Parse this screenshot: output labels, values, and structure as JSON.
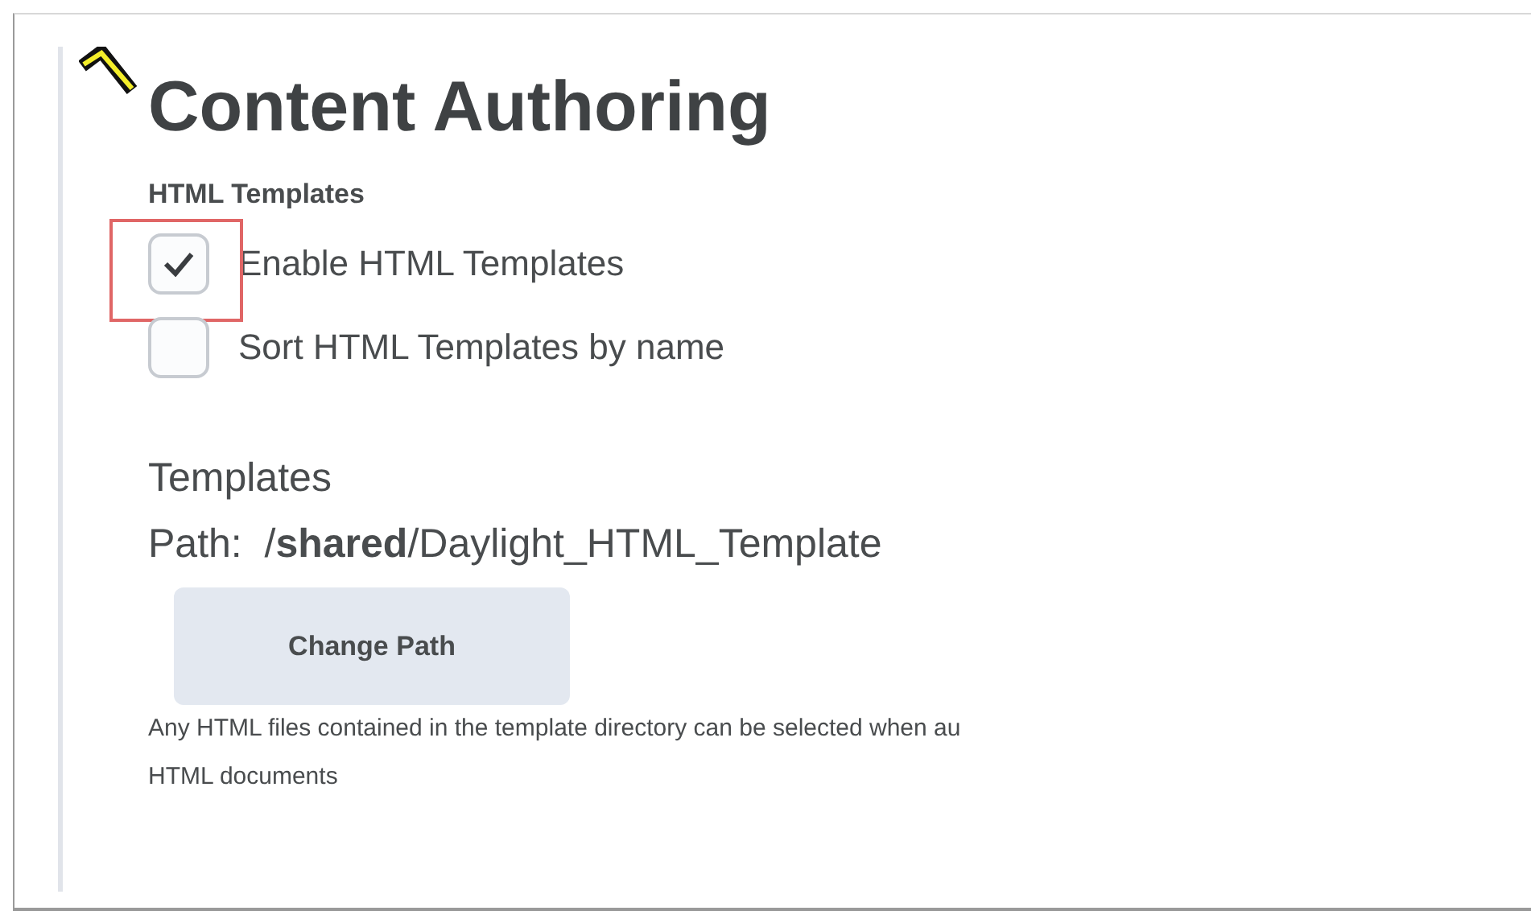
{
  "page": {
    "title": "Content Authoring"
  },
  "section": {
    "heading": "HTML Templates",
    "options": [
      {
        "label": "Enable HTML Templates",
        "checked": true,
        "highlighted": true
      },
      {
        "label": "Sort HTML Templates by name",
        "checked": false,
        "highlighted": false
      }
    ]
  },
  "templates": {
    "heading": "Templates",
    "path": "Path:  /**shared**/Daylight_HTML_Template",
    "button": "Change Path",
    "description": [
      "Any HTML files contained in the template directory can be selected when au",
      "HTML documents"
    ]
  }
}
